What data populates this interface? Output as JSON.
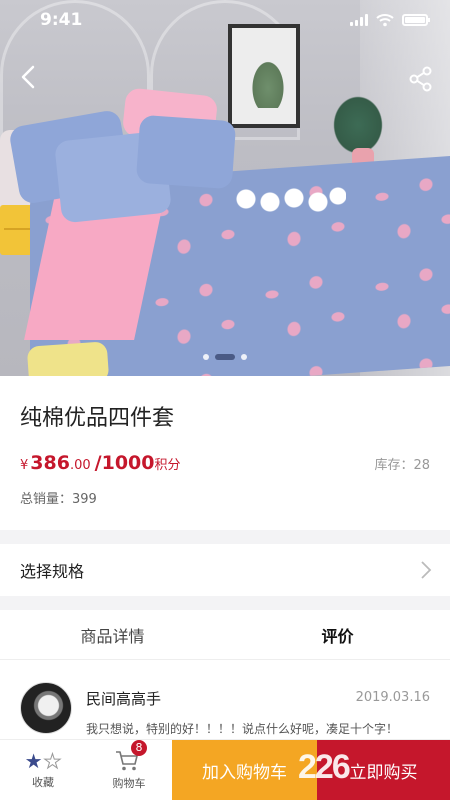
{
  "status_bar": {
    "time": "9:41"
  },
  "hero": {
    "image_count": 3,
    "active_index": 1
  },
  "product": {
    "title": "纯棉优品四件套",
    "price_symbol": "¥",
    "price_int": "386",
    "price_dec": ".00",
    "points_sep": " /",
    "points": "1000",
    "points_unit": "积分",
    "stock": "库存：28",
    "sales": "总销量：399"
  },
  "spec": {
    "label": "选择规格"
  },
  "tabs": [
    {
      "label": "商品详情",
      "active": false
    },
    {
      "label": "评价",
      "active": true
    }
  ],
  "review": {
    "name": "民间高高手",
    "date": "2019.03.16",
    "text": "我只想说，特别的好！！！！说点什么好呢，凑足十个字！"
  },
  "bottom_bar": {
    "favorite_label": "收藏",
    "cart_label": "购物车",
    "cart_count": "8",
    "add_to_cart": "加入购物车",
    "buy_now": "立即购买"
  },
  "colors": {
    "accent_red": "#c5172c",
    "accent_orange": "#f4a623",
    "star_blue": "#3a4a8c"
  },
  "watermark": "226"
}
